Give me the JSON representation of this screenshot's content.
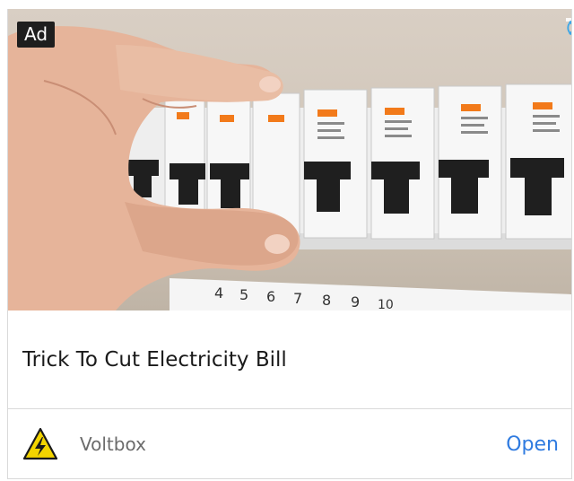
{
  "ad": {
    "badge_label": "Ad",
    "title": "Trick To Cut Electricity Bill",
    "advertiser": "Voltbox",
    "cta_label": "Open",
    "controls": {
      "info_icon": "info-icon",
      "close_icon": "close-icon"
    },
    "brand_icon": "high-voltage-warning-icon",
    "image_subject": "hand-switching-circuit-breakers-photo"
  },
  "breaker_numbers": [
    "4",
    "5",
    "6",
    "7",
    "8",
    "9",
    "10"
  ],
  "colors": {
    "accent": "#2f7be0",
    "info_blue": "#3aa6e8",
    "badge_bg": "#1e1e1e",
    "warning_yellow": "#f3d400",
    "breaker_orange": "#f27a1a"
  }
}
